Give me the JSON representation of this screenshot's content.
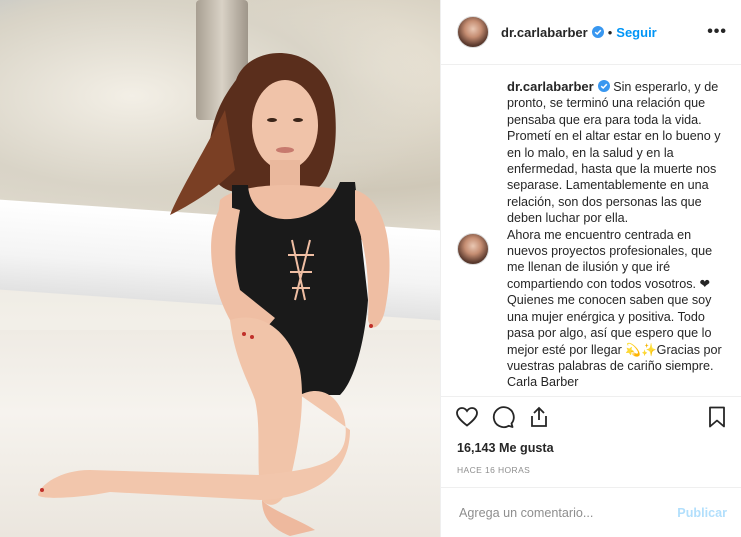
{
  "post": {
    "username": "dr.carlabarber",
    "follow_label": "Seguir",
    "dot": "•",
    "more_label": "•••",
    "caption_paragraphs": [
      "Sin esperarlo, y de pronto, se terminó una relación que pensaba que era para toda la vida. Prometí en el altar estar en lo bueno y en lo malo, en la salud y en la enfermedad, hasta que la muerte nos separase. Lamentablemente en una relación, son dos personas las que deben luchar por ella.",
      "Ahora me encuentro centrada en nuevos proyectos profesionales, que me llenan de ilusión y que iré compartiendo con todos vosotros. ❤ Quienes me conocen saben que soy una mujer enérgica y positiva. Todo pasa por algo, así que espero que lo mejor esté por llegar 💫✨Gracias por vuestras palabras de cariño siempre.",
      "Carla Barber"
    ],
    "likes_label": "16,143 Me gusta",
    "time_label": "HACE 16 HORAS"
  },
  "comment_box": {
    "placeholder": "Agrega un comentario...",
    "publish_label": "Publicar"
  },
  "colors": {
    "accent": "#0095f6",
    "verified": "#3897f0",
    "publish_disabled": "#b2dffc",
    "muted": "#8e8e8e"
  },
  "icons": [
    "heart-icon",
    "comment-icon",
    "share-icon",
    "bookmark-icon",
    "verified-badge-icon"
  ]
}
